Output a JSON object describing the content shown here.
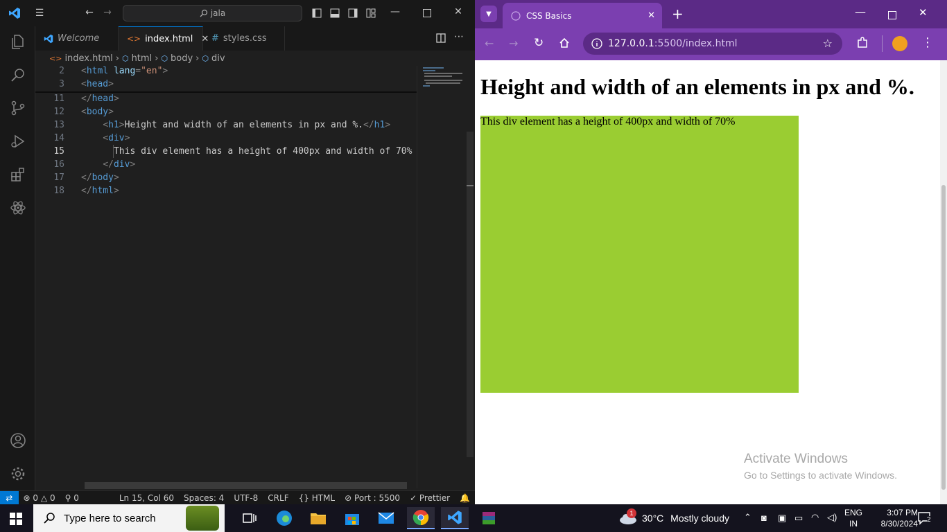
{
  "vscode": {
    "search_text": "jala",
    "tabs": [
      {
        "label": "Welcome"
      },
      {
        "label": "index.html"
      },
      {
        "label": "styles.css"
      }
    ],
    "breadcrumb": [
      "index.html",
      "html",
      "body",
      "div"
    ],
    "lines": [
      {
        "num": "2",
        "parts": [
          [
            "br",
            "<"
          ],
          [
            "tag",
            "html"
          ],
          [
            "attr",
            " lang"
          ],
          [
            "br",
            "="
          ],
          [
            "str",
            "\"en\""
          ],
          [
            "br",
            ">"
          ]
        ]
      },
      {
        "num": "3",
        "parts": [
          [
            "br",
            "<"
          ],
          [
            "tag",
            "head"
          ],
          [
            "br",
            ">"
          ]
        ]
      },
      {
        "num": "11",
        "parts": [
          [
            "br",
            "</"
          ],
          [
            "tag",
            "head"
          ],
          [
            "br",
            ">"
          ]
        ]
      },
      {
        "num": "12",
        "parts": [
          [
            "br",
            "<"
          ],
          [
            "tag",
            "body"
          ],
          [
            "br",
            ">"
          ]
        ]
      },
      {
        "num": "13",
        "parts": [
          [
            "txt",
            "    "
          ],
          [
            "br",
            "<"
          ],
          [
            "tag",
            "h1"
          ],
          [
            "br",
            ">"
          ],
          [
            "txt",
            "Height and width of an elements in px and %."
          ],
          [
            "br",
            "</"
          ],
          [
            "tag",
            "h1"
          ],
          [
            "br",
            ">"
          ]
        ]
      },
      {
        "num": "14",
        "parts": [
          [
            "txt",
            "    "
          ],
          [
            "br",
            "<"
          ],
          [
            "tag",
            "div"
          ],
          [
            "br",
            ">"
          ]
        ]
      },
      {
        "num": "15",
        "parts": [
          [
            "txt",
            "      This div element has a height of 400px and width of 70%"
          ]
        ]
      },
      {
        "num": "16",
        "parts": [
          [
            "txt",
            "    "
          ],
          [
            "br",
            "</"
          ],
          [
            "tag",
            "div"
          ],
          [
            "br",
            ">"
          ]
        ]
      },
      {
        "num": "17",
        "parts": [
          [
            "br",
            "</"
          ],
          [
            "tag",
            "body"
          ],
          [
            "br",
            ">"
          ]
        ]
      },
      {
        "num": "18",
        "parts": [
          [
            "br",
            "</"
          ],
          [
            "tag",
            "html"
          ],
          [
            "br",
            ">"
          ]
        ]
      }
    ],
    "status": {
      "errors": "0",
      "warnings": "0",
      "ports": "0",
      "position": "Ln 15, Col 60",
      "spaces": "Spaces: 4",
      "encoding": "UTF-8",
      "eol": "CRLF",
      "language": "HTML",
      "port": "Port : 5500",
      "formatter": "Prettier"
    }
  },
  "chrome": {
    "tab_title": "CSS Basics",
    "url_host": "127.0.0.1",
    "url_rest": ":5500/index.html",
    "page_heading": "Height and width of an elements in px and %.",
    "page_div_text": "This div element has a height of 400px and width of 70%",
    "div_color": "#9acd32",
    "watermark_title": "Activate Windows",
    "watermark_sub": "Go to Settings to activate Windows."
  },
  "taskbar": {
    "search_placeholder": "Type here to search",
    "weather_temp": "30°C",
    "weather_text": "Mostly cloudy",
    "weather_badge": "1",
    "lang_top": "ENG",
    "lang_bottom": "IN",
    "time": "3:07 PM",
    "date": "8/30/2024",
    "notif_count": "2"
  }
}
